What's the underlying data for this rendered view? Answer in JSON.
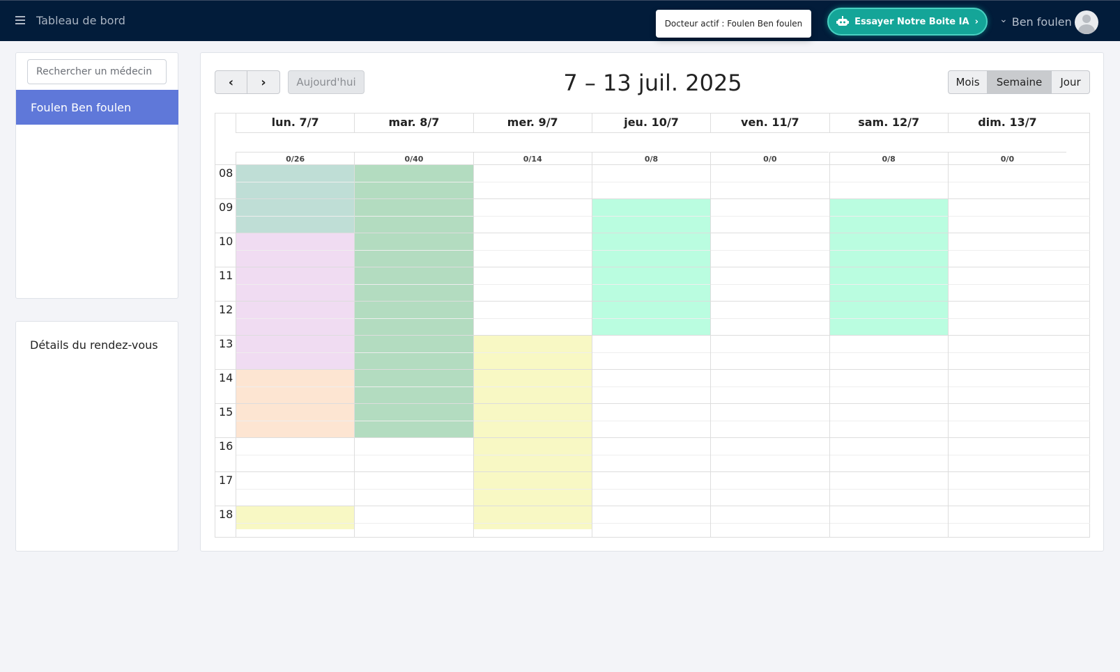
{
  "topbar": {
    "title": "Tableau de bord",
    "active_doctor": "Docteur actif : Foulen Ben foulen",
    "ia_button": "Essayer Notre Boite IA",
    "ia_chevron": "›",
    "user_chevron": "⌄",
    "user_name": "Ben foulen"
  },
  "sidebar": {
    "search_placeholder": "Rechercher un médecin",
    "doctors": [
      "Foulen Ben foulen"
    ],
    "details_title": "Détails du rendez-vous"
  },
  "calendar": {
    "prev": "‹",
    "next": "›",
    "today": "Aujourd'hui",
    "title": "7 – 13 juil. 2025",
    "views": [
      "Mois",
      "Semaine",
      "Jour"
    ],
    "active_view": "Semaine",
    "days": [
      {
        "label": "lun. 7/7",
        "count": "0/26"
      },
      {
        "label": "mar. 8/7",
        "count": "0/40"
      },
      {
        "label": "mer. 9/7",
        "count": "0/14"
      },
      {
        "label": "jeu. 10/7",
        "count": "0/8"
      },
      {
        "label": "ven. 11/7",
        "count": "0/0"
      },
      {
        "label": "sam. 12/7",
        "count": "0/8"
      },
      {
        "label": "dim. 13/7",
        "count": "0/0"
      }
    ],
    "hours": [
      "08",
      "09",
      "10",
      "11",
      "12",
      "13",
      "14",
      "15",
      "16",
      "17",
      "18"
    ],
    "blocks": [
      {
        "day": 0,
        "start": 8,
        "end": 10,
        "color": "#bfded6"
      },
      {
        "day": 0,
        "start": 10,
        "end": 14,
        "color": "#f0dcf2"
      },
      {
        "day": 0,
        "start": 14,
        "end": 16,
        "color": "#fde5d2"
      },
      {
        "day": 0,
        "start": 18,
        "end": 18.7,
        "color": "#f8f8c4"
      },
      {
        "day": 1,
        "start": 8,
        "end": 16,
        "color": "#b3dcc0"
      },
      {
        "day": 2,
        "start": 13,
        "end": 18.7,
        "color": "#f8f8c4"
      },
      {
        "day": 3,
        "start": 9,
        "end": 13,
        "color": "#bafde0"
      },
      {
        "day": 5,
        "start": 9,
        "end": 13,
        "color": "#bafde0"
      }
    ]
  },
  "colors": {
    "topbar": "#021c3a",
    "accent": "#5f78d9",
    "ia_button": "#14a598"
  }
}
